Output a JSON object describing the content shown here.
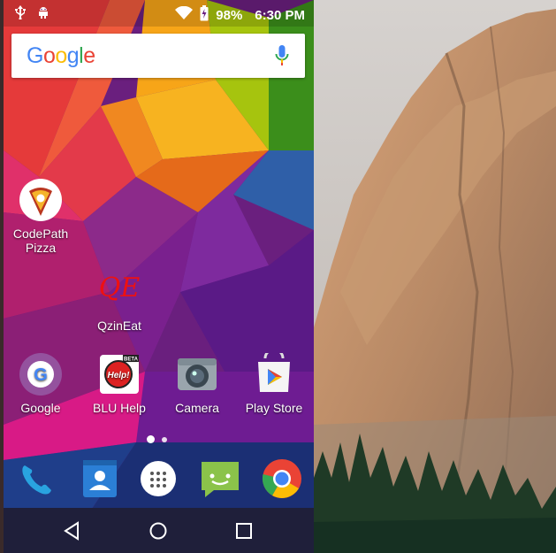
{
  "status_bar": {
    "battery": "98%",
    "time": "6:30 PM",
    "icons": [
      "usb-icon",
      "android-debug-icon",
      "wifi-icon",
      "battery-charging-icon"
    ]
  },
  "search": {
    "logo_text": "Google",
    "mic_icon": "mic-icon"
  },
  "apps": {
    "codepath_pizza": {
      "label": "CodePath\nPizza",
      "icon": "pizza-icon"
    },
    "qzineat": {
      "label": "QzinEat",
      "icon_text": "QE"
    },
    "google": {
      "label": "Google",
      "icon": "google-g-icon"
    },
    "blu_help": {
      "label": "BLU Help",
      "icon_text": "Help!",
      "badge": "BETA"
    },
    "camera": {
      "label": "Camera",
      "icon": "camera-icon"
    },
    "play_store": {
      "label": "Play Store",
      "icon": "play-store-icon"
    }
  },
  "dock": [
    "phone-icon",
    "contacts-icon",
    "app-drawer-icon",
    "messaging-icon",
    "chrome-icon"
  ],
  "nav": [
    "back-icon",
    "home-icon",
    "recents-icon"
  ],
  "colors": {
    "google_blue": "#4285F4",
    "google_red": "#EA4335",
    "google_yellow": "#FBBC05",
    "google_green": "#34A853",
    "navbar": "#1f1f3a"
  }
}
